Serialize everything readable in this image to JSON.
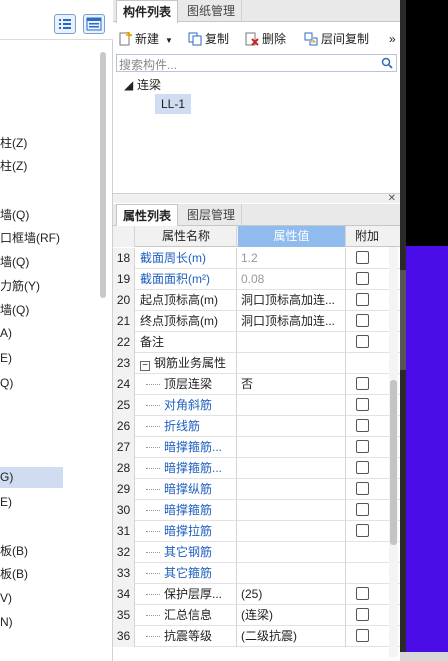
{
  "left_panel": {
    "items": [
      "柱(Z)",
      "柱(Z)",
      "墙(Q)",
      "口框墙(RF)",
      "墙(Q)",
      "力筋(Y)",
      "墙(Q)",
      "A)",
      "E)",
      "Q)",
      "G)",
      "E)",
      "板(B)",
      "板(B)",
      "V)",
      "N)"
    ],
    "selected_index": 10
  },
  "component_tabs": {
    "active": "构件列表",
    "inactive": "图纸管理"
  },
  "toolbar": {
    "new": "新建",
    "copy": "复制",
    "delete": "删除",
    "floor_copy": "层间复制",
    "more": "»"
  },
  "search": {
    "placeholder": "搜索构件..."
  },
  "tree": {
    "group": "连梁",
    "child": "LL-1"
  },
  "property_tabs": {
    "active": "属性列表",
    "inactive": "图层管理"
  },
  "grid": {
    "headers": {
      "name": "属性名称",
      "value": "属性值",
      "extra": "附加"
    },
    "rows": [
      {
        "num": "18",
        "name": "截面周长(m)",
        "value": "1.2",
        "style": "blue",
        "value_style": "gray",
        "check": true,
        "indent": 0
      },
      {
        "num": "19",
        "name": "截面面积(m²)",
        "value": "0.08",
        "style": "blue",
        "value_style": "gray",
        "check": true,
        "indent": 0
      },
      {
        "num": "20",
        "name": "起点顶标高(m)",
        "value": "洞口顶标高加连...",
        "style": "",
        "value_style": "",
        "check": true,
        "indent": 0
      },
      {
        "num": "21",
        "name": "终点顶标高(m)",
        "value": "洞口顶标高加连...",
        "style": "",
        "value_style": "",
        "check": true,
        "indent": 0
      },
      {
        "num": "22",
        "name": "备注",
        "value": "",
        "style": "",
        "value_style": "",
        "check": true,
        "indent": 0
      },
      {
        "num": "23",
        "name": "钢筋业务属性",
        "value": "",
        "style": "",
        "value_style": "",
        "check": false,
        "indent": 0,
        "group": true
      },
      {
        "num": "24",
        "name": "顶层连梁",
        "value": "否",
        "style": "",
        "value_style": "",
        "check": true,
        "indent": 1
      },
      {
        "num": "25",
        "name": "对角斜筋",
        "value": "",
        "style": "blue",
        "value_style": "",
        "check": true,
        "indent": 1
      },
      {
        "num": "26",
        "name": "折线筋",
        "value": "",
        "style": "blue",
        "value_style": "",
        "check": true,
        "indent": 1
      },
      {
        "num": "27",
        "name": "暗撑箍筋...",
        "value": "",
        "style": "blue",
        "value_style": "",
        "check": true,
        "indent": 1
      },
      {
        "num": "28",
        "name": "暗撑箍筋...",
        "value": "",
        "style": "blue",
        "value_style": "",
        "check": true,
        "indent": 1
      },
      {
        "num": "29",
        "name": "暗撑纵筋",
        "value": "",
        "style": "blue",
        "value_style": "",
        "check": true,
        "indent": 1
      },
      {
        "num": "30",
        "name": "暗撑箍筋",
        "value": "",
        "style": "blue",
        "value_style": "",
        "check": true,
        "indent": 1
      },
      {
        "num": "31",
        "name": "暗撑拉筋",
        "value": "",
        "style": "blue",
        "value_style": "",
        "check": true,
        "indent": 1
      },
      {
        "num": "32",
        "name": "其它钢筋",
        "value": "",
        "style": "blue",
        "value_style": "",
        "check": false,
        "indent": 1
      },
      {
        "num": "33",
        "name": "其它箍筋",
        "value": "",
        "style": "blue",
        "value_style": "",
        "check": false,
        "indent": 1
      },
      {
        "num": "34",
        "name": "保护层厚...",
        "value": "(25)",
        "style": "",
        "value_style": "",
        "check": true,
        "indent": 1
      },
      {
        "num": "35",
        "name": "汇总信息",
        "value": "(连梁)",
        "style": "",
        "value_style": "",
        "check": true,
        "indent": 1
      },
      {
        "num": "36",
        "name": "抗震等级",
        "value": "(二级抗震)",
        "style": "",
        "value_style": "",
        "check": true,
        "indent": 1
      }
    ]
  },
  "colors": {
    "header_accent": "#8fbbee",
    "selection": "#cfdcf2",
    "link_blue": "#1f5fbf",
    "viewport_purple": "#4a0de8"
  }
}
